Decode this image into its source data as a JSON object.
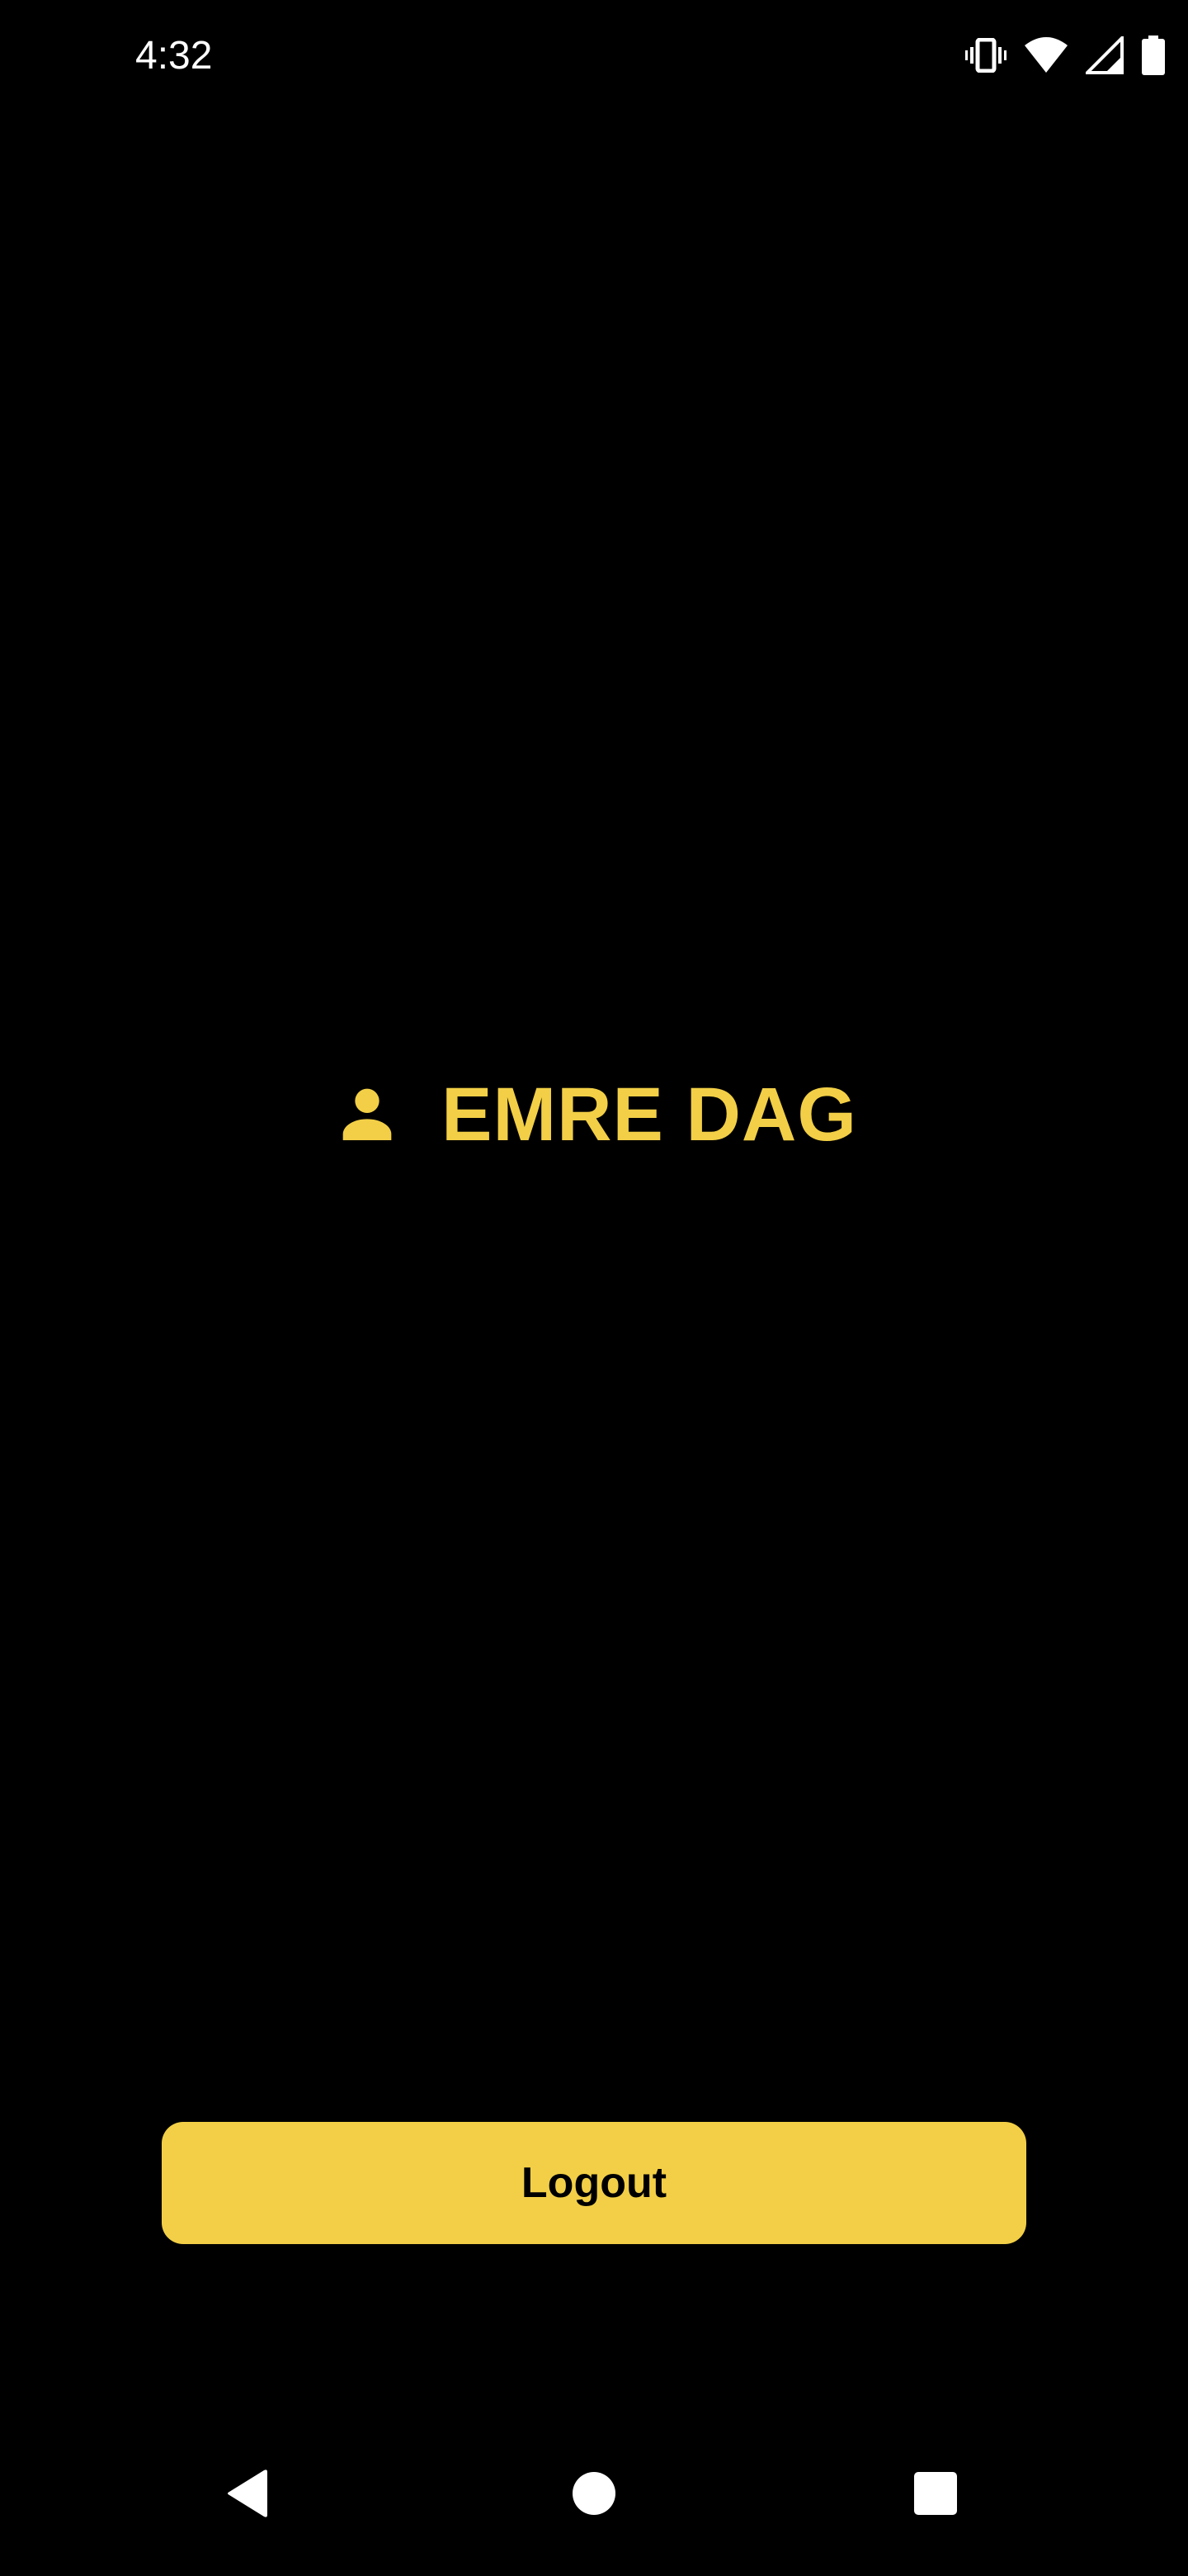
{
  "status_bar": {
    "time": "4:32",
    "icons": [
      "vibrate-icon",
      "wifi-icon",
      "signal-icon",
      "battery-icon"
    ]
  },
  "profile": {
    "icon": "person-icon",
    "name": "EMRE DAG"
  },
  "actions": {
    "logout_label": "Logout"
  },
  "navigation": {
    "icons": [
      "back-icon",
      "home-icon",
      "recents-icon"
    ]
  },
  "colors": {
    "background": "#000000",
    "accent": "#f2cf46",
    "button_text": "#000000",
    "system_icons": "#ffffff"
  }
}
